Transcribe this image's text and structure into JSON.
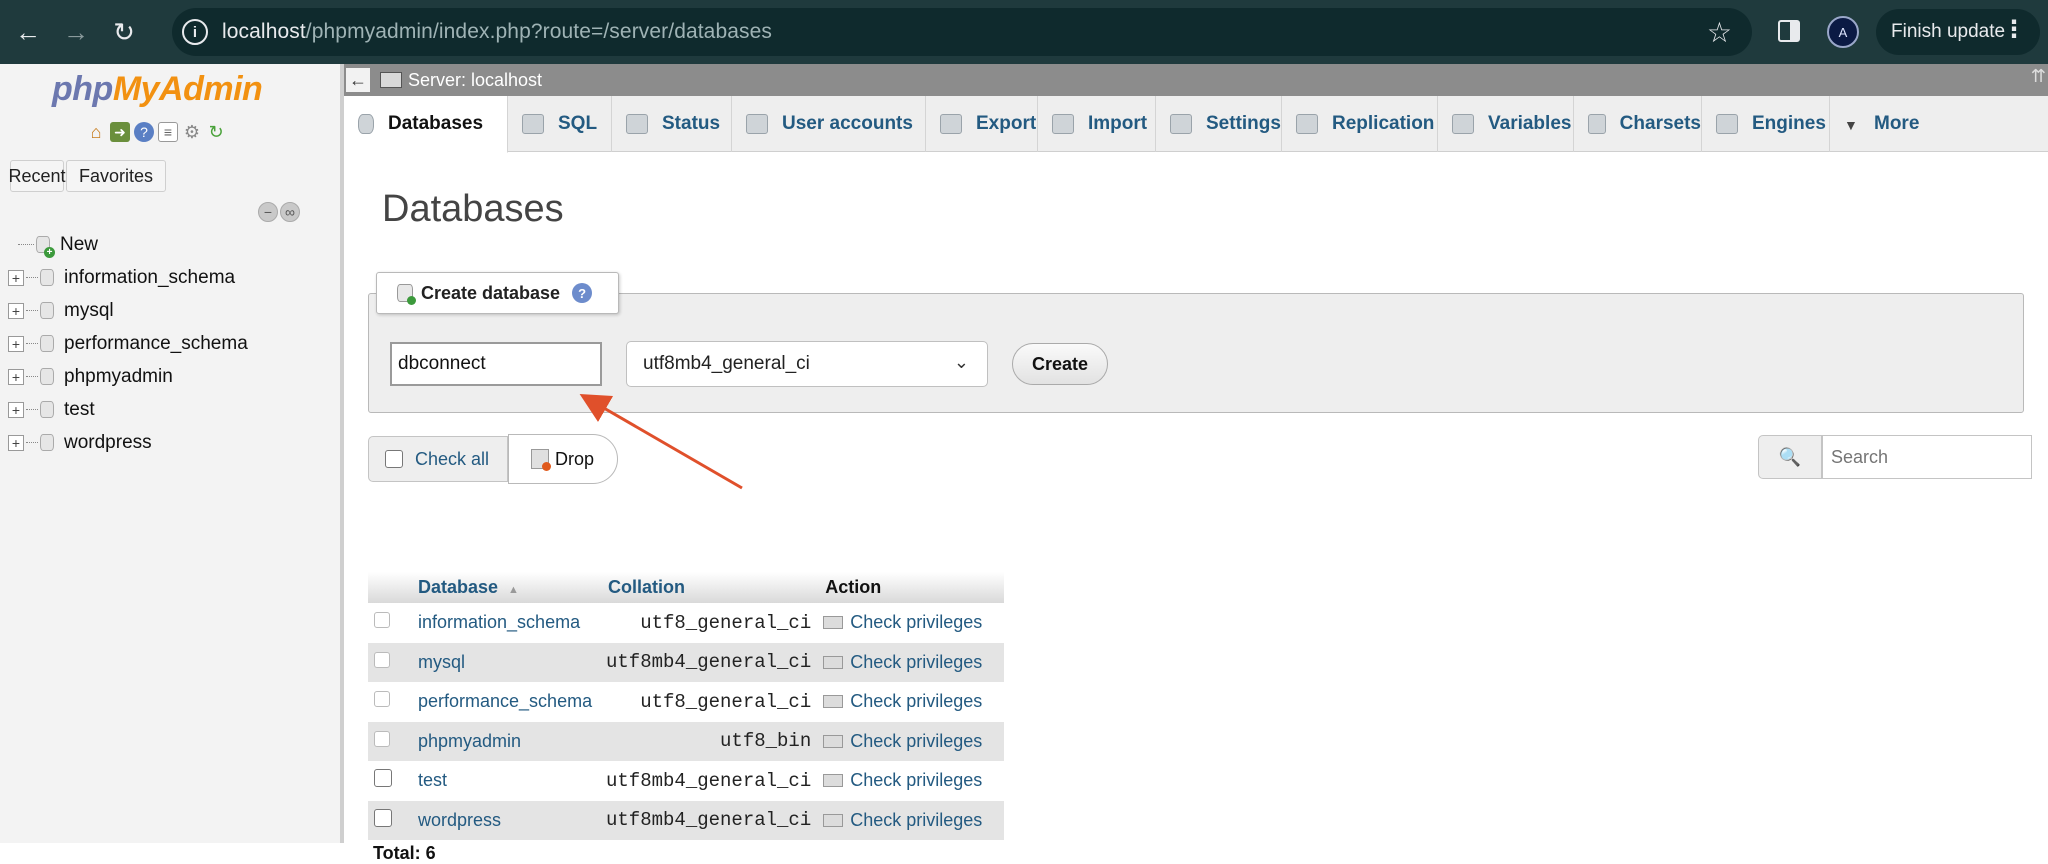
{
  "browser": {
    "url_host": "localhost",
    "url_path": "/phpmyadmin/index.php?route=/server/databases",
    "finish_update_label": "Finish update",
    "profile_initial": "A"
  },
  "sidebar": {
    "logo_php": "php",
    "logo_my": "MyAdmin",
    "tabs": [
      "Recent",
      "Favorites"
    ],
    "tree": [
      {
        "label": "New"
      },
      {
        "label": "information_schema"
      },
      {
        "label": "mysql"
      },
      {
        "label": "performance_schema"
      },
      {
        "label": "phpmyadmin"
      },
      {
        "label": "test"
      },
      {
        "label": "wordpress"
      }
    ]
  },
  "server_bar": {
    "label": "Server: localhost"
  },
  "top_menu": [
    {
      "label": "Databases",
      "icon": "database-icon",
      "active": true
    },
    {
      "label": "SQL",
      "icon": "sql-icon"
    },
    {
      "label": "Status",
      "icon": "status-icon"
    },
    {
      "label": "User accounts",
      "icon": "users-icon"
    },
    {
      "label": "Export",
      "icon": "export-icon"
    },
    {
      "label": "Import",
      "icon": "import-icon"
    },
    {
      "label": "Settings",
      "icon": "wrench-icon"
    },
    {
      "label": "Replication",
      "icon": "replication-icon"
    },
    {
      "label": "Variables",
      "icon": "variables-icon"
    },
    {
      "label": "Charsets",
      "icon": "charsets-icon"
    },
    {
      "label": "Engines",
      "icon": "engines-icon"
    },
    {
      "label": "More",
      "icon": "caret-down-icon"
    }
  ],
  "page": {
    "title": "Databases",
    "create_legend": "Create database",
    "db_name_value": "dbconnect",
    "collation_value": "utf8mb4_general_ci",
    "create_button": "Create",
    "check_all": "Check all",
    "drop_button": "Drop",
    "search_placeholder": "Search"
  },
  "table": {
    "headers": {
      "database": "Database",
      "collation": "Collation",
      "action": "Action"
    },
    "rows": [
      {
        "name": "information_schema",
        "collation": "utf8_general_ci",
        "action": "Check privileges"
      },
      {
        "name": "mysql",
        "collation": "utf8mb4_general_ci",
        "action": "Check privileges"
      },
      {
        "name": "performance_schema",
        "collation": "utf8_general_ci",
        "action": "Check privileges"
      },
      {
        "name": "phpmyadmin",
        "collation": "utf8_bin",
        "action": "Check privileges"
      },
      {
        "name": "test",
        "collation": "utf8mb4_general_ci",
        "action": "Check privileges"
      },
      {
        "name": "wordpress",
        "collation": "utf8mb4_general_ci",
        "action": "Check privileges"
      }
    ],
    "total": "Total: 6"
  },
  "colors": {
    "link": "#235a81",
    "chrome_bg": "#1f3a3d",
    "annotation_arrow": "#e0502b"
  }
}
